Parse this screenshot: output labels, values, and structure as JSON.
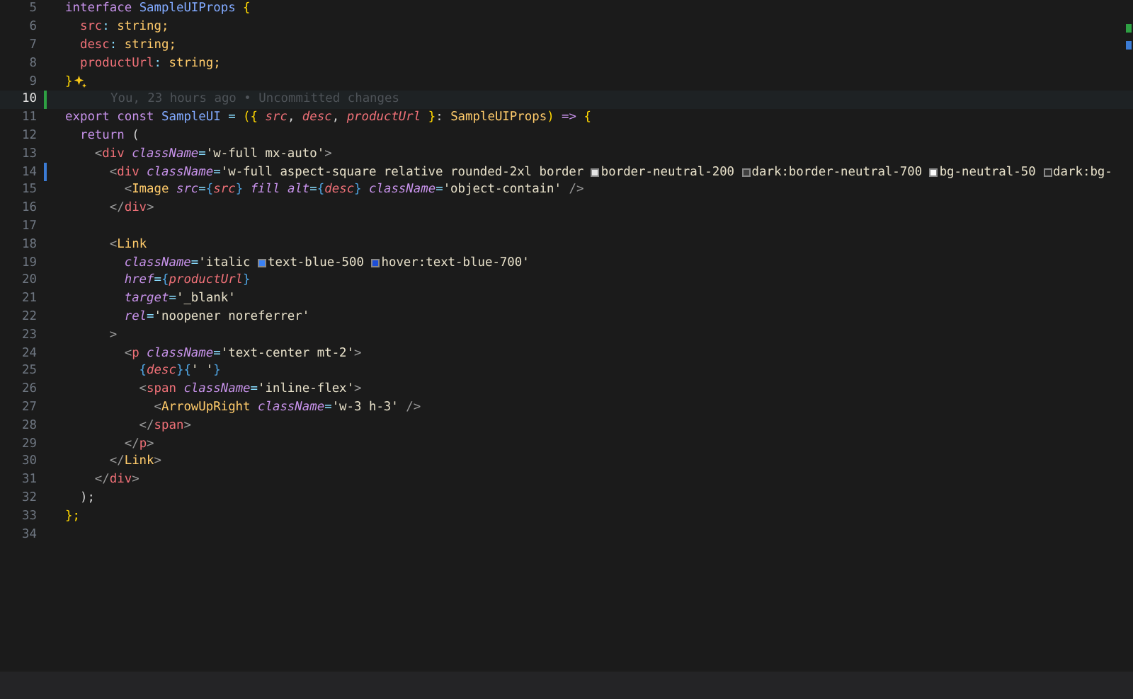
{
  "editor": {
    "lines": [
      {
        "number": "5",
        "tokens": [
          {
            "text": "interface ",
            "kind": "kw"
          },
          {
            "text": "SampleUIProps ",
            "kind": "type"
          },
          {
            "text": "{",
            "kind": "brace"
          }
        ]
      },
      {
        "number": "6",
        "tokens": [
          {
            "text": "  src",
            "kind": "prop"
          },
          {
            "text": ":",
            "kind": "op"
          },
          {
            "text": " string;",
            "kind": "ptype"
          }
        ]
      },
      {
        "number": "7",
        "tokens": [
          {
            "text": "  desc",
            "kind": "prop"
          },
          {
            "text": ":",
            "kind": "op"
          },
          {
            "text": " string;",
            "kind": "ptype"
          }
        ]
      },
      {
        "number": "8",
        "tokens": [
          {
            "text": "  productUrl",
            "kind": "prop"
          },
          {
            "text": ":",
            "kind": "op"
          },
          {
            "text": " string;",
            "kind": "ptype"
          }
        ]
      },
      {
        "number": "9",
        "tokens": [
          {
            "text": "}",
            "kind": "brace"
          }
        ],
        "sparkle": true
      },
      {
        "number": "10",
        "current": true,
        "added": true,
        "blame": "You, 23 hours ago • Uncommitted changes"
      },
      {
        "number": "11",
        "tokens": [
          {
            "text": "export const ",
            "kind": "kw"
          },
          {
            "text": "SampleUI",
            "kind": "type"
          },
          {
            "text": " = ",
            "kind": "op"
          },
          {
            "text": "({ ",
            "kind": "brace"
          },
          {
            "text": "src",
            "kind": "param"
          },
          {
            "text": ", ",
            "kind": "plain"
          },
          {
            "text": "desc",
            "kind": "param"
          },
          {
            "text": ", ",
            "kind": "plain"
          },
          {
            "text": "productUrl",
            "kind": "param"
          },
          {
            "text": " }",
            "kind": "brace"
          },
          {
            "text": ": ",
            "kind": "plain"
          },
          {
            "text": "SampleUIProps",
            "kind": "ptype"
          },
          {
            "text": ")",
            "kind": "brace"
          },
          {
            "text": " => ",
            "kind": "kw"
          },
          {
            "text": "{",
            "kind": "brace"
          }
        ]
      },
      {
        "number": "12",
        "tokens": [
          {
            "text": "  return",
            "kind": "kw"
          },
          {
            "text": " (",
            "kind": "plain"
          }
        ]
      },
      {
        "number": "13",
        "tokens": [
          {
            "text": "    <",
            "kind": "punct"
          },
          {
            "text": "div ",
            "kind": "tag"
          },
          {
            "text": "className",
            "kind": "attr"
          },
          {
            "text": "=",
            "kind": "op"
          },
          {
            "text": "'w-full mx-auto'",
            "kind": "str"
          },
          {
            "text": ">",
            "kind": "punct"
          }
        ]
      },
      {
        "number": "14",
        "modified": true,
        "tokens": [
          {
            "text": "      <",
            "kind": "punct"
          },
          {
            "text": "div ",
            "kind": "tag"
          },
          {
            "text": "className",
            "kind": "attr"
          },
          {
            "text": "=",
            "kind": "op"
          },
          {
            "text": "'w-full aspect-square relative rounded-2xl border ",
            "kind": "str"
          },
          {
            "kind": "swatch",
            "color": "#e5e5e5"
          },
          {
            "text": "border-neutral-200 ",
            "kind": "str"
          },
          {
            "kind": "swatch",
            "color": "#404040"
          },
          {
            "text": "dark:border-neutral-700 ",
            "kind": "str"
          },
          {
            "kind": "swatch",
            "color": "#fafafa"
          },
          {
            "text": "bg-neutral-50 ",
            "kind": "str"
          },
          {
            "kind": "swatch",
            "color": "#262626"
          },
          {
            "text": "dark:bg-",
            "kind": "str"
          }
        ]
      },
      {
        "number": "15",
        "tokens": [
          {
            "text": "        <",
            "kind": "punct"
          },
          {
            "text": "Image ",
            "kind": "comp"
          },
          {
            "text": "src",
            "kind": "attr"
          },
          {
            "text": "=",
            "kind": "op"
          },
          {
            "text": "{",
            "kind": "jsx"
          },
          {
            "text": "src",
            "kind": "param"
          },
          {
            "text": "} ",
            "kind": "jsx"
          },
          {
            "text": "fill alt",
            "kind": "attr"
          },
          {
            "text": "=",
            "kind": "op"
          },
          {
            "text": "{",
            "kind": "jsx"
          },
          {
            "text": "desc",
            "kind": "param"
          },
          {
            "text": "} ",
            "kind": "jsx"
          },
          {
            "text": "className",
            "kind": "attr"
          },
          {
            "text": "=",
            "kind": "op"
          },
          {
            "text": "'object-contain'",
            "kind": "str"
          },
          {
            "text": " />",
            "kind": "punct"
          }
        ]
      },
      {
        "number": "16",
        "tokens": [
          {
            "text": "      </",
            "kind": "punct"
          },
          {
            "text": "div",
            "kind": "tag"
          },
          {
            "text": ">",
            "kind": "punct"
          }
        ]
      },
      {
        "number": "17"
      },
      {
        "number": "18",
        "tokens": [
          {
            "text": "      <",
            "kind": "punct"
          },
          {
            "text": "Link",
            "kind": "comp"
          }
        ]
      },
      {
        "number": "19",
        "tokens": [
          {
            "text": "        className",
            "kind": "attr"
          },
          {
            "text": "=",
            "kind": "op"
          },
          {
            "text": "'italic ",
            "kind": "str"
          },
          {
            "kind": "swatch",
            "color": "#3b82f6"
          },
          {
            "text": "text-blue-500 ",
            "kind": "str"
          },
          {
            "kind": "swatch",
            "color": "#1d4ed8"
          },
          {
            "text": "hover:text-blue-700'",
            "kind": "str"
          }
        ]
      },
      {
        "number": "20",
        "tokens": [
          {
            "text": "        href",
            "kind": "attr"
          },
          {
            "text": "=",
            "kind": "op"
          },
          {
            "text": "{",
            "kind": "jsx"
          },
          {
            "text": "productUrl",
            "kind": "param"
          },
          {
            "text": "}",
            "kind": "jsx"
          }
        ]
      },
      {
        "number": "21",
        "tokens": [
          {
            "text": "        target",
            "kind": "attr"
          },
          {
            "text": "=",
            "kind": "op"
          },
          {
            "text": "'_blank'",
            "kind": "str"
          }
        ]
      },
      {
        "number": "22",
        "tokens": [
          {
            "text": "        rel",
            "kind": "attr"
          },
          {
            "text": "=",
            "kind": "op"
          },
          {
            "text": "'noopener noreferrer'",
            "kind": "str"
          }
        ]
      },
      {
        "number": "23",
        "tokens": [
          {
            "text": "      >",
            "kind": "punct"
          }
        ]
      },
      {
        "number": "24",
        "tokens": [
          {
            "text": "        <",
            "kind": "punct"
          },
          {
            "text": "p ",
            "kind": "tag"
          },
          {
            "text": "className",
            "kind": "attr"
          },
          {
            "text": "=",
            "kind": "op"
          },
          {
            "text": "'text-center mt-2'",
            "kind": "str"
          },
          {
            "text": ">",
            "kind": "punct"
          }
        ]
      },
      {
        "number": "25",
        "tokens": [
          {
            "text": "          {",
            "kind": "jsx"
          },
          {
            "text": "desc",
            "kind": "param"
          },
          {
            "text": "}{",
            "kind": "jsx"
          },
          {
            "text": "' '",
            "kind": "str"
          },
          {
            "text": "}",
            "kind": "jsx"
          }
        ]
      },
      {
        "number": "26",
        "tokens": [
          {
            "text": "          <",
            "kind": "punct"
          },
          {
            "text": "span ",
            "kind": "tag"
          },
          {
            "text": "className",
            "kind": "attr"
          },
          {
            "text": "=",
            "kind": "op"
          },
          {
            "text": "'inline-flex'",
            "kind": "str"
          },
          {
            "text": ">",
            "kind": "punct"
          }
        ]
      },
      {
        "number": "27",
        "tokens": [
          {
            "text": "            <",
            "kind": "punct"
          },
          {
            "text": "ArrowUpRight ",
            "kind": "comp"
          },
          {
            "text": "className",
            "kind": "attr"
          },
          {
            "text": "=",
            "kind": "op"
          },
          {
            "text": "'w-3 h-3'",
            "kind": "str"
          },
          {
            "text": " />",
            "kind": "punct"
          }
        ]
      },
      {
        "number": "28",
        "tokens": [
          {
            "text": "          </",
            "kind": "punct"
          },
          {
            "text": "span",
            "kind": "tag"
          },
          {
            "text": ">",
            "kind": "punct"
          }
        ]
      },
      {
        "number": "29",
        "tokens": [
          {
            "text": "        </",
            "kind": "punct"
          },
          {
            "text": "p",
            "kind": "tag"
          },
          {
            "text": ">",
            "kind": "punct"
          }
        ]
      },
      {
        "number": "30",
        "tokens": [
          {
            "text": "      </",
            "kind": "punct"
          },
          {
            "text": "Link",
            "kind": "comp"
          },
          {
            "text": ">",
            "kind": "punct"
          }
        ]
      },
      {
        "number": "31",
        "tokens": [
          {
            "text": "    </",
            "kind": "punct"
          },
          {
            "text": "div",
            "kind": "tag"
          },
          {
            "text": ">",
            "kind": "punct"
          }
        ]
      },
      {
        "number": "32",
        "tokens": [
          {
            "text": "  );",
            "kind": "plain"
          }
        ]
      },
      {
        "number": "33",
        "tokens": [
          {
            "text": "};",
            "kind": "brace"
          }
        ]
      },
      {
        "number": "34"
      }
    ]
  }
}
